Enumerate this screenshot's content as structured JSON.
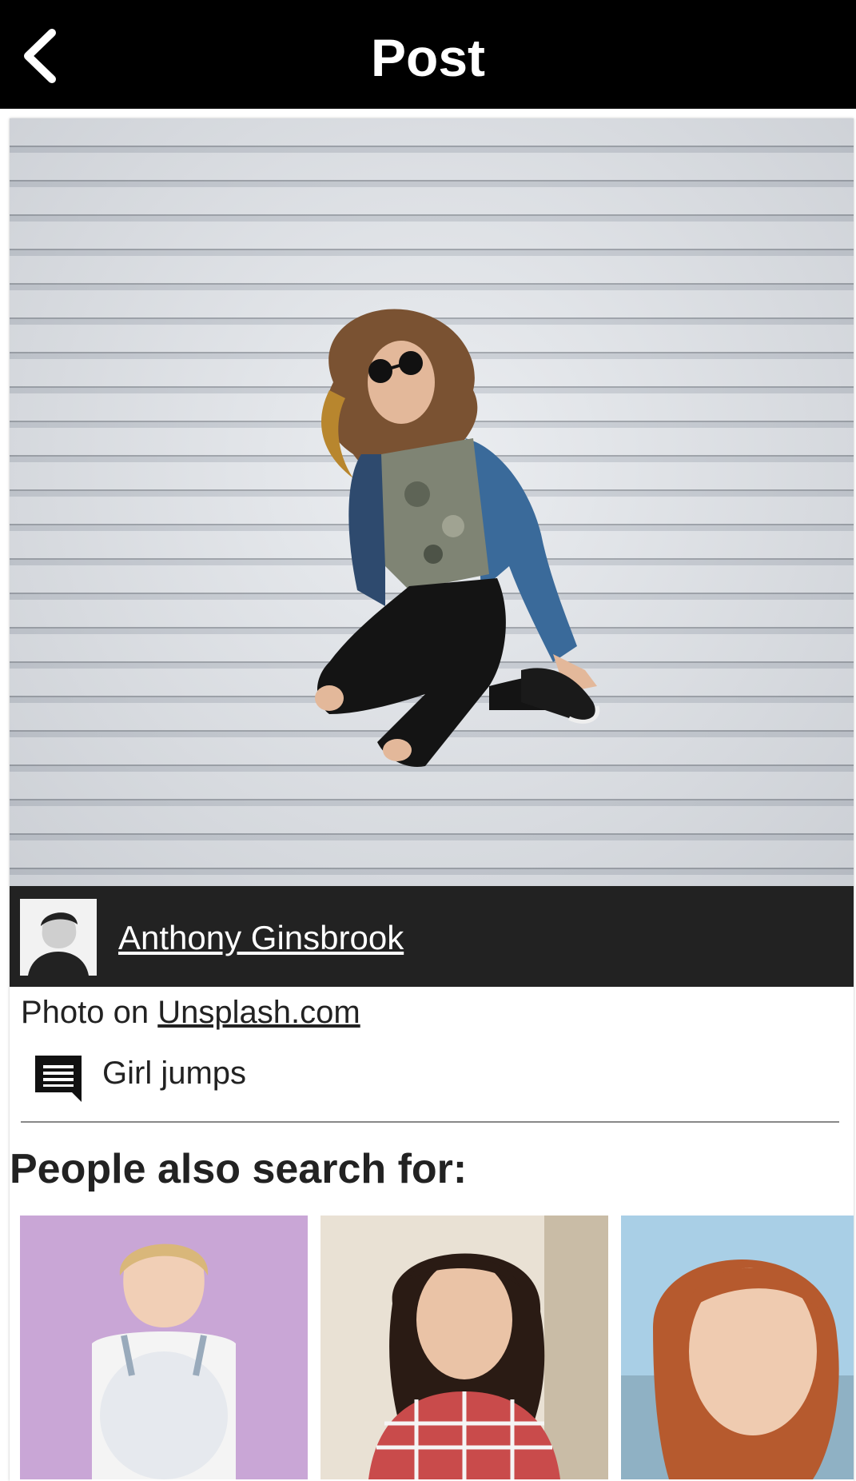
{
  "appbar": {
    "title": "Post",
    "back_icon": "chevron-left-icon"
  },
  "post": {
    "image_alt": "Girl jumps",
    "author": "Anthony Ginsbrook",
    "source_prefix": "Photo on ",
    "source_link": "Unsplash.com",
    "comment_icon": "comment-icon",
    "description": "Girl jumps"
  },
  "related": {
    "title": "People also search for:",
    "items": [
      {
        "alt": "Blonde woman on purple background"
      },
      {
        "alt": "Dark-haired woman in plaid shirt"
      },
      {
        "alt": "Red-haired girl portrait"
      }
    ]
  },
  "colors": {
    "appbar_bg": "#000000",
    "author_bar_bg": "#222222",
    "text": "#222222"
  }
}
